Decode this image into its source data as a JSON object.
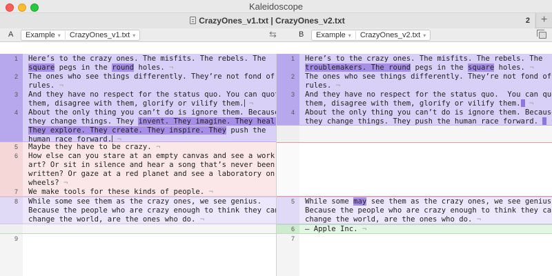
{
  "window": {
    "title": "Kaleidoscope"
  },
  "tab": {
    "title": "CrazyOnes_v1.txt | CrazyOnes_v2.txt",
    "count": "2",
    "add_label": "+"
  },
  "left": {
    "side": "A",
    "breadcrumb": [
      "Example",
      "CrazyOnes_v1.txt"
    ],
    "lines": [
      {
        "n": "1",
        "a": "Here’s to the crazy ones. The misfits. The rebels. The"
      },
      {
        "n": "",
        "b": "square",
        "c": " pegs in the ",
        "d": "round",
        "e": " holes. "
      },
      {
        "n": "2",
        "a": "The ones who see things differently. They’re not fond of"
      },
      {
        "n": "",
        "a": "rules."
      },
      {
        "n": "3",
        "a": "And they have no respect for the status quo. You can quote"
      },
      {
        "n": "",
        "a": "them, disagree with them, glorify or vilify them."
      },
      {
        "n": "4",
        "a": "About the only thing you can’t do is ignore them. Because"
      },
      {
        "n": "",
        "a": "they change things. They ",
        "b": "invent. They imagine. They heal."
      },
      {
        "n": "",
        "b": "They explore. They create. They inspire. They",
        "c": " push the"
      },
      {
        "n": "",
        "a": "human race forward."
      },
      {
        "n": "5",
        "a": "Maybe they have to be crazy. "
      },
      {
        "n": "6",
        "a": "How else can you stare at an empty canvas and see a work of"
      },
      {
        "n": "",
        "a": "art? Or sit in silence and hear a song that’s never been"
      },
      {
        "n": "",
        "a": "written? Or gaze at a red planet and see a laboratory on"
      },
      {
        "n": "",
        "a": "wheels? "
      },
      {
        "n": "7",
        "a": "We make tools for these kinds of people. "
      },
      {
        "n": "8",
        "a": "While some see them as the crazy ones, we see genius."
      },
      {
        "n": "",
        "a": "Because the people who are crazy enough to think they can"
      },
      {
        "n": "",
        "a": "change the world, are the ones who do. "
      },
      {
        "n": "9",
        "a": ""
      }
    ]
  },
  "right": {
    "side": "B",
    "breadcrumb": [
      "Example",
      "CrazyOnes_v2.txt"
    ],
    "lines": [
      {
        "n": "1",
        "a": "Here’s to the crazy ones. The misfits. The rebels. The"
      },
      {
        "n": "",
        "b": "troublemakers. The round",
        "c": " pegs in the ",
        "d": "square",
        "e": " holes. "
      },
      {
        "n": "2",
        "a": "The ones who see things differently. They’re not fond of"
      },
      {
        "n": "",
        "a": "rules."
      },
      {
        "n": "3",
        "a": "And they have no respect for the status quo.  You can quote"
      },
      {
        "n": "",
        "a": "them, disagree with them, glorify or vilify them."
      },
      {
        "n": "4",
        "a": "About the only thing you can’t do is ignore them. Because"
      },
      {
        "n": "",
        "a": "they change things. They push the human race forward. "
      },
      {
        "n": "5",
        "a": "While some ",
        "b": "may",
        "c": " see them as the crazy ones, we see genius."
      },
      {
        "n": "",
        "a": "Because the people who are crazy enough to think they can"
      },
      {
        "n": "",
        "a": "change the world, are the ones who do. "
      },
      {
        "n": "6",
        "a": "– Apple Inc. "
      },
      {
        "n": "7",
        "a": ""
      }
    ]
  },
  "pilcrow": "¬",
  "icons": {
    "swap": "swap-arrows-icon",
    "layout": "layout-icon",
    "document": "document-icon"
  }
}
